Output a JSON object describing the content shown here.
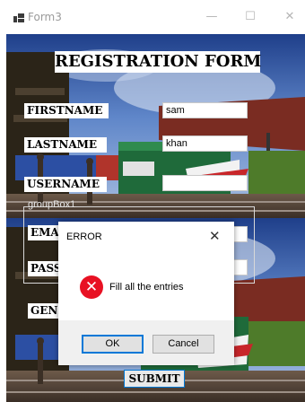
{
  "window": {
    "title": "Form3",
    "minimize_glyph": "—",
    "maximize_glyph": "☐",
    "close_glyph": "✕"
  },
  "form": {
    "title": "REGISTRATION FORM",
    "labels": {
      "firstname": "FIRSTNAME",
      "lastname": "LASTNAME",
      "username": "USERNAME",
      "email": "EMAIL",
      "password": "PASSWORD",
      "gender": "GENDER"
    },
    "fields": {
      "firstname": "sam",
      "lastname": "khan",
      "username": "",
      "email": "",
      "password": ""
    },
    "groupbox_label": "groupBox1",
    "submit_label": "SUBMIT"
  },
  "dialog": {
    "title": "ERROR",
    "close_glyph": "✕",
    "icon": "error-icon",
    "icon_glyph": "✕",
    "message": "Fill all the entries",
    "ok_label": "OK",
    "cancel_label": "Cancel"
  },
  "colors": {
    "accent": "#0078d7",
    "error": "#e81123"
  }
}
